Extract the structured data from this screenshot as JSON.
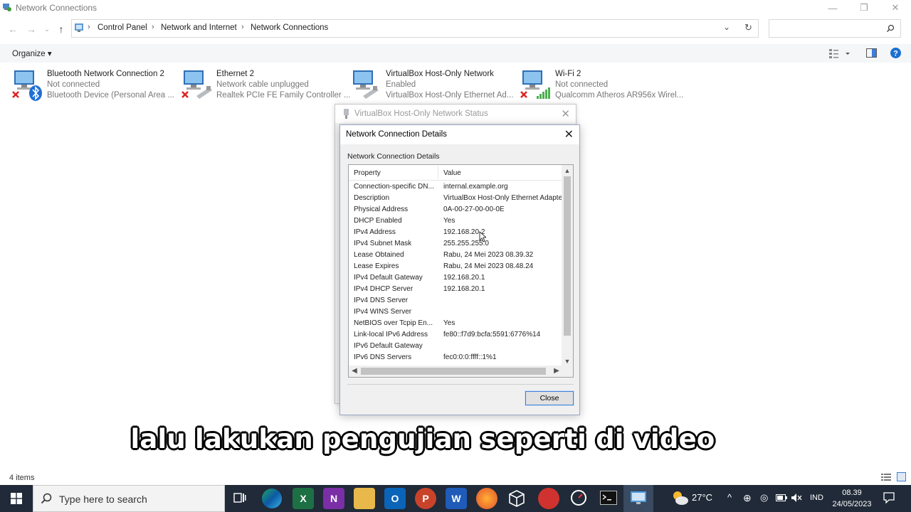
{
  "window": {
    "title": "Network Connections",
    "minimize": "—",
    "restore": "❐",
    "close": "✕"
  },
  "address": {
    "back": "←",
    "forward": "→",
    "recent": "⌄",
    "up": "↑",
    "breadcrumb": [
      "Control Panel",
      "Network and Internet",
      "Network Connections"
    ],
    "dropdown": "⌄",
    "refresh": "↻",
    "search_placeholder": ""
  },
  "toolbar": {
    "organize_label": "Organize ▾"
  },
  "connections": [
    {
      "name": "Bluetooth Network Connection 2",
      "status": "Not connected",
      "device": "Bluetooth Device (Personal Area ..."
    },
    {
      "name": "Ethernet 2",
      "status": "Network cable unplugged",
      "device": "Realtek PCIe FE Family Controller ..."
    },
    {
      "name": "VirtualBox Host-Only Network",
      "status": "Enabled",
      "device": "VirtualBox Host-Only Ethernet Ad..."
    },
    {
      "name": "Wi-Fi 2",
      "status": "Not connected",
      "device": "Qualcomm Atheros AR956x Wirel..."
    }
  ],
  "bg_dialog": {
    "title": "VirtualBox Host-Only Network Status",
    "close": "✕"
  },
  "dialog": {
    "title": "Network Connection Details",
    "close": "✕",
    "section_label": "Network Connection Details",
    "columns": {
      "property": "Property",
      "value": "Value"
    },
    "rows": [
      {
        "property": "Connection-specific DN...",
        "value": "internal.example.org"
      },
      {
        "property": "Description",
        "value": "VirtualBox Host-Only Ethernet Adapter"
      },
      {
        "property": "Physical Address",
        "value": "0A-00-27-00-00-0E"
      },
      {
        "property": "DHCP Enabled",
        "value": "Yes"
      },
      {
        "property": "IPv4 Address",
        "value": "192.168.20.2"
      },
      {
        "property": "IPv4 Subnet Mask",
        "value": "255.255.255.0"
      },
      {
        "property": "Lease Obtained",
        "value": "Rabu, 24 Mei 2023 08.39.32"
      },
      {
        "property": "Lease Expires",
        "value": "Rabu, 24 Mei 2023 08.48.24"
      },
      {
        "property": "IPv4 Default Gateway",
        "value": "192.168.20.1"
      },
      {
        "property": "IPv4 DHCP Server",
        "value": "192.168.20.1"
      },
      {
        "property": "IPv4 DNS Server",
        "value": ""
      },
      {
        "property": "IPv4 WINS Server",
        "value": ""
      },
      {
        "property": "NetBIOS over Tcpip En...",
        "value": "Yes"
      },
      {
        "property": "Link-local IPv6 Address",
        "value": "fe80::f7d9:bcfa:5591:6776%14"
      },
      {
        "property": "IPv6 Default Gateway",
        "value": ""
      },
      {
        "property": "IPv6 DNS Servers",
        "value": "fec0:0:0:ffff::1%1"
      }
    ],
    "close_button": "Close"
  },
  "caption": "lalu lakukan pengujian seperti di video",
  "statusbar": {
    "items": "4 items"
  },
  "taskbar": {
    "search_placeholder": "Type here to search",
    "weather": "27°C",
    "language": "IND",
    "time": "08.39",
    "date": "24/05/2023"
  },
  "colors": {
    "taskbar": "#202a38",
    "accent": "#3c7fd8"
  }
}
